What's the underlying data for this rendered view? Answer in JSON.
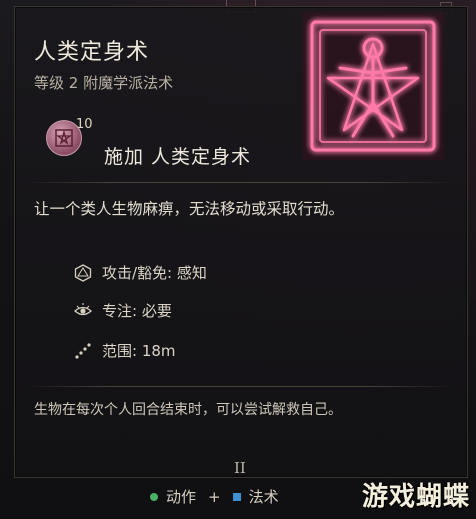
{
  "spell": {
    "name": "人类定身术",
    "subtitle": "等级 2 附魔学派法术",
    "cast_level": "10",
    "cast_label": "施加 人类定身术",
    "description": "让一个类人生物麻痹，无法移动或采取行动。",
    "properties": [
      {
        "icon": "d20-icon",
        "text": "攻击/豁免: 感知"
      },
      {
        "icon": "concentration-eye-icon",
        "text": "专注: 必要"
      },
      {
        "icon": "range-dots-icon",
        "text": "范围: 18m"
      }
    ],
    "note": "生物在每次个人回合结束时，可以尝试解救自己。"
  },
  "pager": "II",
  "footer": {
    "action_label": "动作",
    "plus": "+",
    "spell_slot_label": "法术",
    "action_color": "#4caf6a",
    "slot_color": "#3d8fd1"
  },
  "watermark": "游戏蝴蝶",
  "colors": {
    "icon_glow": "#ff6fa0",
    "icon_frame": "#b64a6e"
  }
}
